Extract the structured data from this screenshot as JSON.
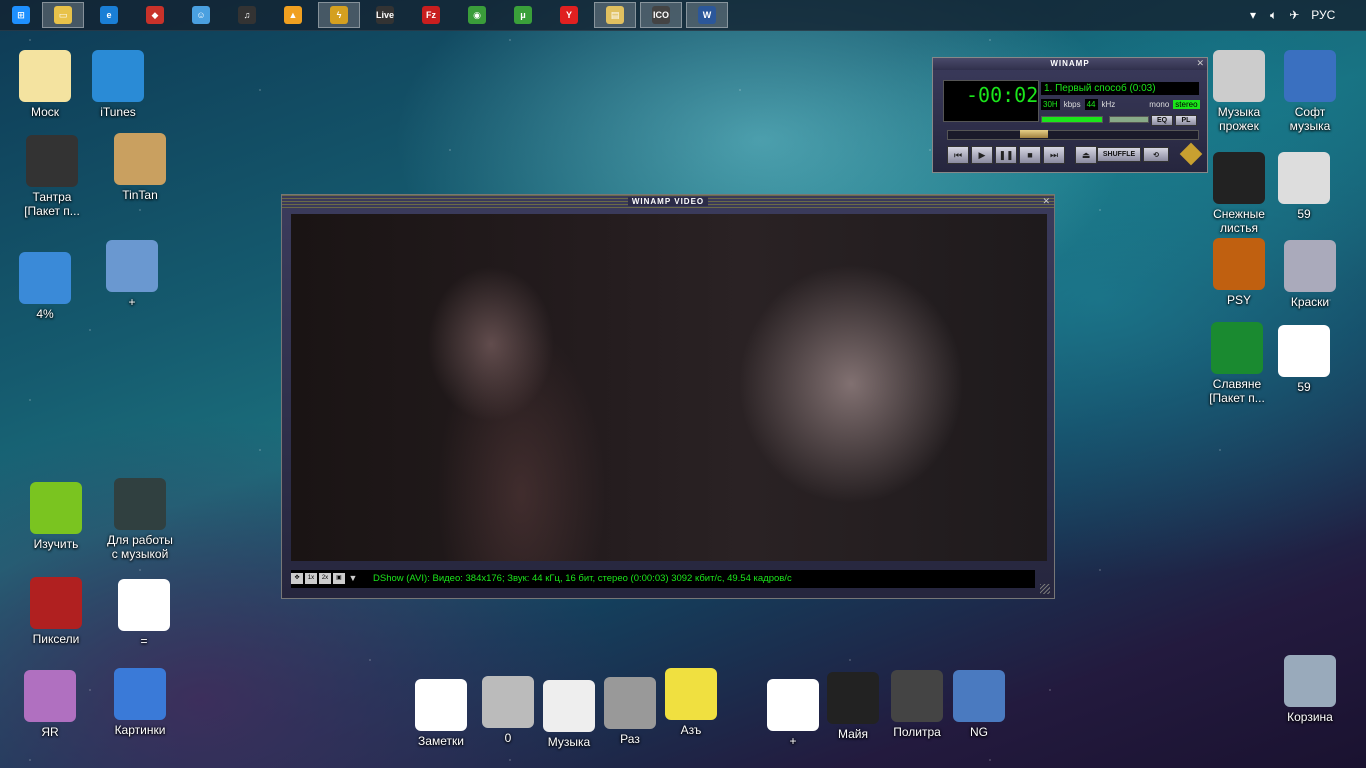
{
  "taskbar": {
    "buttons": [
      {
        "name": "start-icon",
        "color": "#1e90ff",
        "glyph": "⊞"
      },
      {
        "name": "explorer-icon",
        "color": "#e8c24a",
        "glyph": "▭",
        "active": true
      },
      {
        "name": "ie-icon",
        "color": "#1a7fd6",
        "glyph": "e"
      },
      {
        "name": "app-icon",
        "color": "#c8322a",
        "glyph": "◆"
      },
      {
        "name": "finder-icon",
        "color": "#4aa0e0",
        "glyph": "☺"
      },
      {
        "name": "media-icon",
        "color": "#333",
        "glyph": "♫"
      },
      {
        "name": "aimp-icon",
        "color": "#f0a020",
        "glyph": "▲"
      },
      {
        "name": "winamp-icon",
        "color": "#d4a020",
        "glyph": "ϟ",
        "active": true
      },
      {
        "name": "live-icon",
        "color": "#333",
        "glyph": "Live"
      },
      {
        "name": "filezilla-icon",
        "color": "#c81e1e",
        "glyph": "Fz"
      },
      {
        "name": "chrome-icon",
        "color": "#3a9d3a",
        "glyph": "◉"
      },
      {
        "name": "utorrent-icon",
        "color": "#3aa03a",
        "glyph": "μ"
      },
      {
        "name": "yandex-icon",
        "color": "#e02020",
        "glyph": "Y"
      },
      {
        "name": "folder-icon",
        "color": "#e0c060",
        "glyph": "▤",
        "active": true
      },
      {
        "name": "ico-icon",
        "color": "#444",
        "glyph": "ICO",
        "active": true
      },
      {
        "name": "word-icon",
        "color": "#2b579a",
        "glyph": "W",
        "active": true
      }
    ],
    "tray": {
      "lang": "РУС"
    }
  },
  "icons_left": [
    {
      "name": "icon-mosk",
      "label": "Моск",
      "color": "#f4e3a0"
    },
    {
      "name": "icon-itunes",
      "label": "iTunes",
      "color": "#2a8bd6"
    },
    {
      "name": "icon-tantra",
      "label": "Тантра\n[Пакет п...",
      "color": "#333"
    },
    {
      "name": "icon-tintan",
      "label": "TinTan",
      "color": "#c9a060"
    },
    {
      "name": "icon-4",
      "label": "4%",
      "color": "#3a8ad8"
    },
    {
      "name": "icon-plus",
      "label": "+",
      "color": "#6a98d0"
    },
    {
      "name": "icon-izuchit",
      "label": "Изучить",
      "color": "#7ac420"
    },
    {
      "name": "icon-dlya-raboty",
      "label": "Для работы\nс музыкой",
      "color": "#304040"
    },
    {
      "name": "icon-pikseli",
      "label": "Пиксели",
      "color": "#b02020"
    },
    {
      "name": "icon-equals",
      "label": "=",
      "color": "#fff"
    },
    {
      "name": "icon-yar",
      "label": "ЯR",
      "color": "#b070c0"
    },
    {
      "name": "icon-kartinki",
      "label": "Картинки",
      "color": "#3a7ad8"
    }
  ],
  "icons_right": [
    {
      "name": "icon-muzyka-prozhek",
      "label": "Музыка\nпрожек",
      "color": "#ccc"
    },
    {
      "name": "icon-soft-muzyka",
      "label": "Софт\nмузыка",
      "color": "#3a70c0"
    },
    {
      "name": "icon-snezhnye-listya",
      "label": "Снежные\nлистья",
      "color": "#222"
    },
    {
      "name": "icon-59-a",
      "label": "59",
      "color": "#ddd"
    },
    {
      "name": "icon-psy",
      "label": "PSY",
      "color": "#c06010"
    },
    {
      "name": "icon-kraski",
      "label": "Краски",
      "color": "#aab"
    },
    {
      "name": "icon-slavyane",
      "label": "Славяне\n[Пакет п...",
      "color": "#1a8a30"
    },
    {
      "name": "icon-59-b",
      "label": "59",
      "color": "#fff"
    },
    {
      "name": "icon-korzina",
      "label": "Корзина",
      "color": "#9ab"
    }
  ],
  "icons_bottom": [
    {
      "name": "icon-zametki",
      "label": "Заметки",
      "color": "#fff"
    },
    {
      "name": "icon-0",
      "label": "0",
      "color": "#bbb"
    },
    {
      "name": "icon-muzyka",
      "label": "Музыка",
      "color": "#eee"
    },
    {
      "name": "icon-raz",
      "label": "Раз",
      "color": "#999"
    },
    {
      "name": "icon-az",
      "label": "Азъ",
      "color": "#f0e040"
    },
    {
      "name": "icon-plus-b",
      "label": "+",
      "color": "#fff"
    },
    {
      "name": "icon-maiya",
      "label": "Майя",
      "color": "#222"
    },
    {
      "name": "icon-politra",
      "label": "Политра",
      "color": "#444"
    },
    {
      "name": "icon-ng",
      "label": "NG",
      "color": "#4a7ac0"
    }
  ],
  "winamp": {
    "title": "WINAMP",
    "time": "-00:02",
    "track": "1. Первый способ (0:03)",
    "kbps": "30H",
    "kbps_label": "kbps",
    "khz": "44",
    "khz_label": "kHz",
    "mono": "mono",
    "stereo": "stereo",
    "eq": "EQ",
    "pl": "PL",
    "shuffle": "SHUFFLE"
  },
  "video": {
    "title": "WINAMP VIDEO",
    "status": "DShow (AVI): Видео: 384x176; Звук: 44 кГц, 16 бит, стерео (0:00:03) 3092 кбит/с, 49.54 кадров/с"
  }
}
